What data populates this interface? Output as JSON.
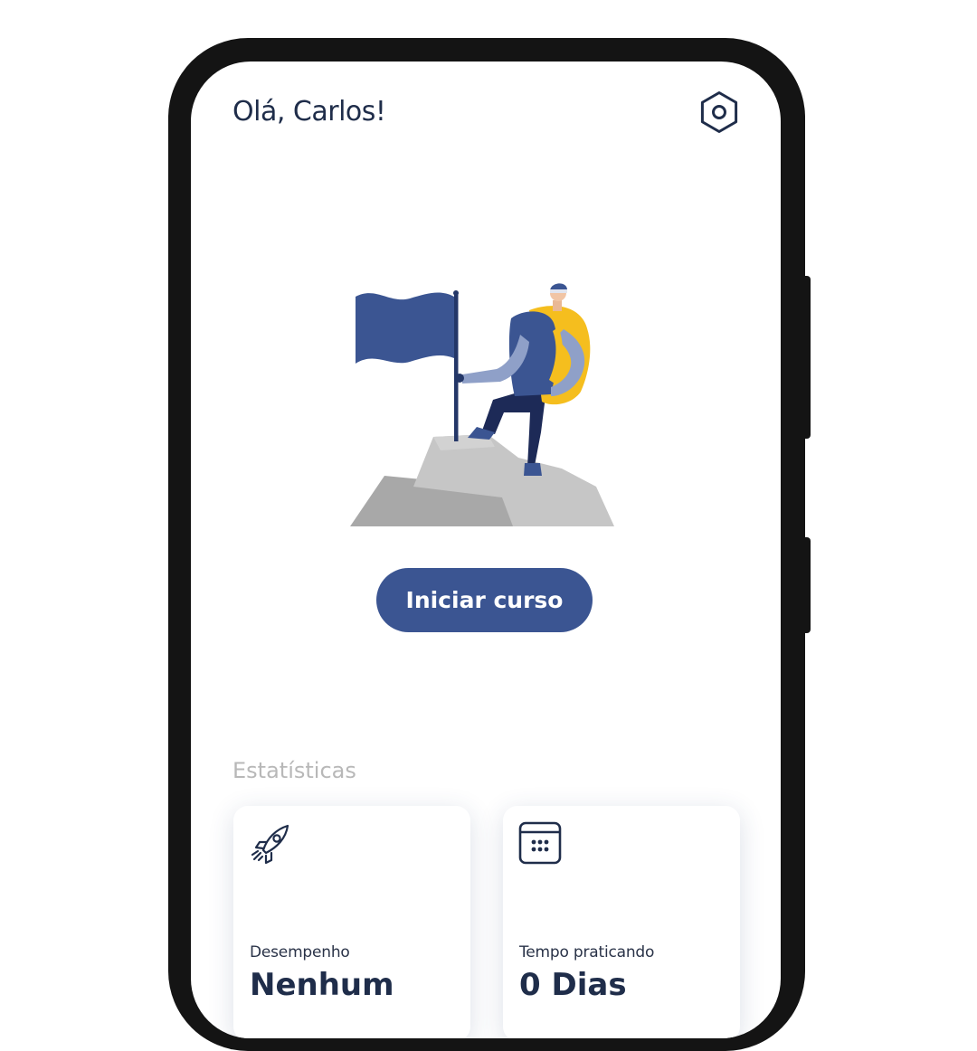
{
  "header": {
    "greeting": "Olá, Carlos!",
    "settings_icon": "settings-icon"
  },
  "hero": {
    "illustration": "hiker-with-flag-on-mountain"
  },
  "cta": {
    "label": "Iniciar curso"
  },
  "stats": {
    "title": "Estatísticas",
    "cards": [
      {
        "icon": "rocket-icon",
        "label": "Desempenho",
        "value": "Nenhum"
      },
      {
        "icon": "calendar-icon",
        "label": "Tempo praticando",
        "value": "0 Dias"
      }
    ]
  },
  "colors": {
    "primary": "#3b5592",
    "text_dark": "#1f2d4a",
    "muted": "#b8b8b8",
    "accent_yellow": "#f5be1e",
    "rock_gray": "#c4c4c4"
  }
}
